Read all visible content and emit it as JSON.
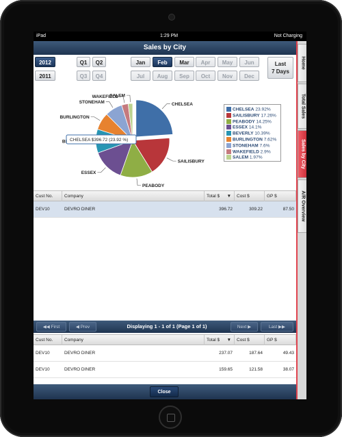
{
  "status_bar": {
    "device": "iPad",
    "time": "1:29 PM",
    "battery": "Not Charging"
  },
  "title": "Sales by City",
  "years": [
    {
      "label": "2012",
      "selected": true
    },
    {
      "label": "2011",
      "selected": false
    }
  ],
  "quarters": [
    {
      "label": "Q1"
    },
    {
      "label": "Q2"
    },
    {
      "label": "Q3"
    },
    {
      "label": "Q4"
    }
  ],
  "months": [
    {
      "label": "Jan",
      "state": "enabled"
    },
    {
      "label": "Feb",
      "state": "selected"
    },
    {
      "label": "Mar",
      "state": "enabled"
    },
    {
      "label": "Apr",
      "state": "disabled"
    },
    {
      "label": "May",
      "state": "disabled"
    },
    {
      "label": "Jun",
      "state": "disabled"
    },
    {
      "label": "Jul",
      "state": "disabled"
    },
    {
      "label": "Aug",
      "state": "disabled"
    },
    {
      "label": "Sep",
      "state": "disabled"
    },
    {
      "label": "Oct",
      "state": "disabled"
    },
    {
      "label": "Nov",
      "state": "disabled"
    },
    {
      "label": "Dec",
      "state": "disabled"
    }
  ],
  "last7": {
    "line1": "Last",
    "line2": "7 Days"
  },
  "side_tabs": [
    {
      "label": "Home"
    },
    {
      "label": "Total Sales"
    },
    {
      "label": "Sales by City"
    },
    {
      "label": "A/R Overview"
    }
  ],
  "chart_data": {
    "type": "pie",
    "slices": [
      {
        "name": "CHELSEA",
        "value": 23.92,
        "color": "#3f6fa8"
      },
      {
        "name": "SAILISBURY",
        "value": 17.26,
        "color": "#b8363a"
      },
      {
        "name": "PEABODY",
        "value": 14.25,
        "color": "#8fae45"
      },
      {
        "name": "ESSEX",
        "value": 14.1,
        "color": "#6c4f91"
      },
      {
        "name": "BEVERLY",
        "value": 10.39,
        "color": "#2895b3"
      },
      {
        "name": "BURLINGTON",
        "value": 7.62,
        "color": "#e7822f"
      },
      {
        "name": "STONEHAM",
        "value": 7.6,
        "color": "#8ba4d2"
      },
      {
        "name": "WAKEFIELD",
        "value": 2.9,
        "color": "#c57a7e"
      },
      {
        "name": "SALEM",
        "value": 1.97,
        "color": "#bcd28f"
      }
    ],
    "legend": [
      {
        "name": "CHELSEA",
        "value": "23.92%"
      },
      {
        "name": "SAILISBURY",
        "value": "17.26%"
      },
      {
        "name": "PEABODY",
        "value": "14.25%"
      },
      {
        "name": "ESSEX",
        "value": "14.1%"
      },
      {
        "name": "BEVERLY",
        "value": "10.39%"
      },
      {
        "name": "BURLINGTON",
        "value": "7.62%"
      },
      {
        "name": "STONEHAM",
        "value": "7.6%"
      },
      {
        "name": "WAKEFIELD",
        "value": "2.9%"
      },
      {
        "name": "SALEM",
        "value": "1.97%"
      }
    ],
    "tooltip": "CHELSEA $396.72 (23.92 %)"
  },
  "top_table": {
    "headers": [
      "Cust No.",
      "Company",
      "Total $",
      "Cost $",
      "GP $"
    ],
    "rows": [
      [
        "DEV10",
        "DEVRO DINER",
        "396.72",
        "309.22",
        "87.50"
      ]
    ]
  },
  "pager": {
    "first": "First",
    "prev": "Prev",
    "info": "Displaying 1 - 1 of 1 (Page 1 of 1)",
    "next": "Next",
    "last": "Last"
  },
  "bottom_table": {
    "headers": [
      "Cust No.",
      "Company",
      "Total $",
      "Cost $",
      "GP $"
    ],
    "rows": [
      [
        "DEV10",
        "DEVRO DINER",
        "237.07",
        "187.64",
        "49.43"
      ],
      [
        "DEV10",
        "DEVRO DINER",
        "159.65",
        "121.58",
        "38.07"
      ]
    ]
  },
  "footer": {
    "close": "Close"
  }
}
